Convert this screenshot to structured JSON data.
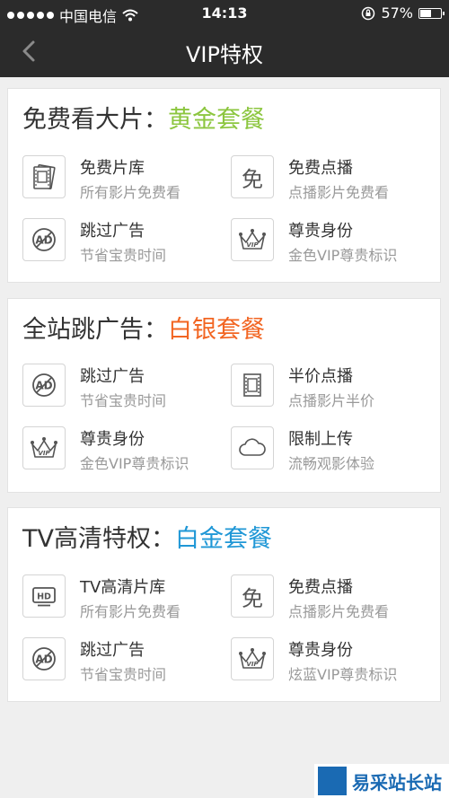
{
  "status_bar": {
    "carrier": "中国电信",
    "time": "14:13",
    "battery": "57%",
    "battery_level": 0.57
  },
  "nav": {
    "title": "VIP特权"
  },
  "colors": {
    "gold": "#8cc63f",
    "silver": "#f26522",
    "platinum": "#1f97d6"
  },
  "cards": [
    {
      "title": "免费看大片：",
      "package": "黄金套餐",
      "items": [
        {
          "icon": "film-library-icon",
          "name": "免费片库",
          "desc": "所有影片免费看"
        },
        {
          "icon": "free-icon",
          "glyph": "免",
          "name": "免费点播",
          "desc": "点播影片免费看"
        },
        {
          "icon": "no-ad-icon",
          "name": "跳过广告",
          "desc": "节省宝贵时间"
        },
        {
          "icon": "vip-crown-icon",
          "name": "尊贵身份",
          "desc": "金色VIP尊贵标识"
        }
      ]
    },
    {
      "title": "全站跳广告：",
      "package": "白银套餐",
      "items": [
        {
          "icon": "no-ad-icon",
          "name": "跳过广告",
          "desc": "节省宝贵时间"
        },
        {
          "icon": "film-strip-icon",
          "name": "半价点播",
          "desc": "点播影片半价"
        },
        {
          "icon": "vip-crown-icon",
          "name": "尊贵身份",
          "desc": "金色VIP尊贵标识"
        },
        {
          "icon": "cloud-icon",
          "name": "限制上传",
          "desc": "流畅观影体验"
        }
      ]
    },
    {
      "title": "TV高清特权：",
      "package": "白金套餐",
      "items": [
        {
          "icon": "hd-tv-icon",
          "name": "TV高清片库",
          "desc": "所有影片免费看"
        },
        {
          "icon": "free-icon",
          "glyph": "免",
          "name": "免费点播",
          "desc": "点播影片免费看"
        },
        {
          "icon": "no-ad-icon",
          "name": "跳过广告",
          "desc": "节省宝贵时间"
        },
        {
          "icon": "vip-crown-icon",
          "name": "尊贵身份",
          "desc": "炫蓝VIP尊贵标识"
        }
      ]
    }
  ],
  "watermark": {
    "text": "易采站长站"
  }
}
